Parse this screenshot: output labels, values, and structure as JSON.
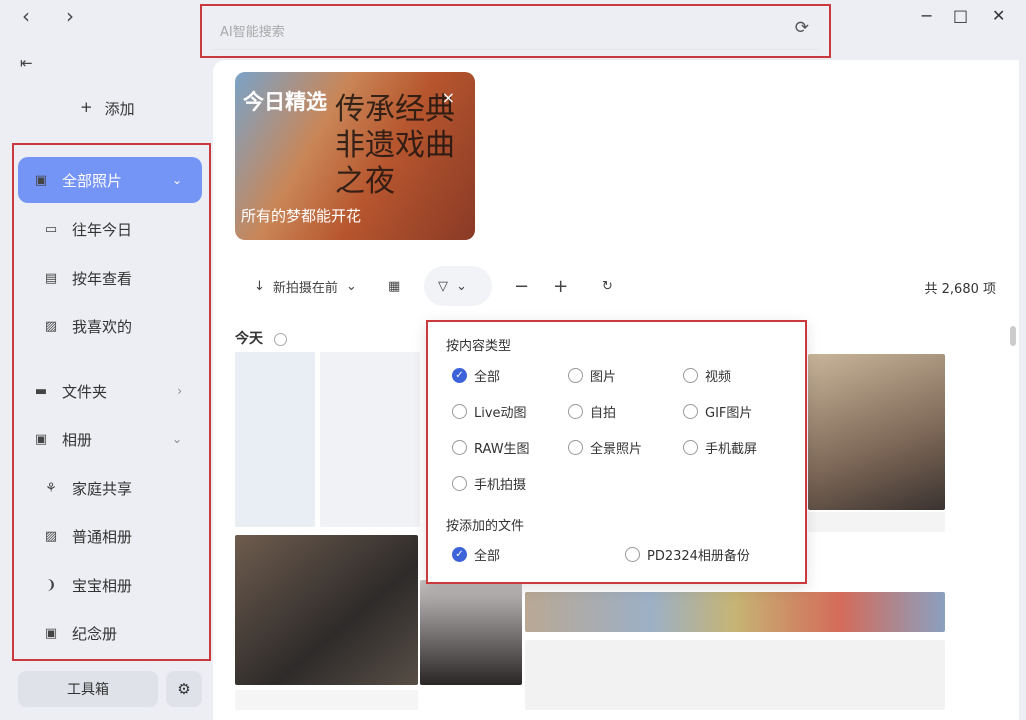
{
  "nav": {
    "back": "‹",
    "forward": "›"
  },
  "search": {
    "placeholder": "AI智能搜索"
  },
  "window": {
    "minimize": "−",
    "maximize": "□",
    "close": "✕"
  },
  "sidebar": {
    "add_label": "添加",
    "items": [
      {
        "label": "全部照片"
      },
      {
        "label": "往年今日"
      },
      {
        "label": "按年查看"
      },
      {
        "label": "我喜欢的"
      },
      {
        "label": "文件夹"
      },
      {
        "label": "相册"
      },
      {
        "label": "家庭共享"
      },
      {
        "label": "普通相册"
      },
      {
        "label": "宝宝相册"
      },
      {
        "label": "纪念册"
      }
    ],
    "toolbox": "工具箱"
  },
  "banner": {
    "title": "今日精选",
    "subtitle": "所有的梦都能开花",
    "poster_text": "传承经典 非遗戏曲之夜"
  },
  "toolbar": {
    "sort": "新拍摄在前",
    "count": "共 2,680 项"
  },
  "section": {
    "today": "今天"
  },
  "filter": {
    "content_title": "按内容类型",
    "content_options": [
      {
        "label": "全部",
        "checked": true
      },
      {
        "label": "图片"
      },
      {
        "label": "视频"
      },
      {
        "label": "Live动图"
      },
      {
        "label": "自拍"
      },
      {
        "label": "GIF图片"
      },
      {
        "label": "RAW生图"
      },
      {
        "label": "全景照片"
      },
      {
        "label": "手机截屏"
      },
      {
        "label": "手机拍摄"
      }
    ],
    "file_title": "按添加的文件",
    "file_options": [
      {
        "label": "全部",
        "checked": true
      },
      {
        "label": "PD2324相册备份"
      }
    ]
  },
  "colors": {
    "accent": "#7595f6",
    "check": "#3d63d8",
    "highlight": "#c9393d"
  }
}
